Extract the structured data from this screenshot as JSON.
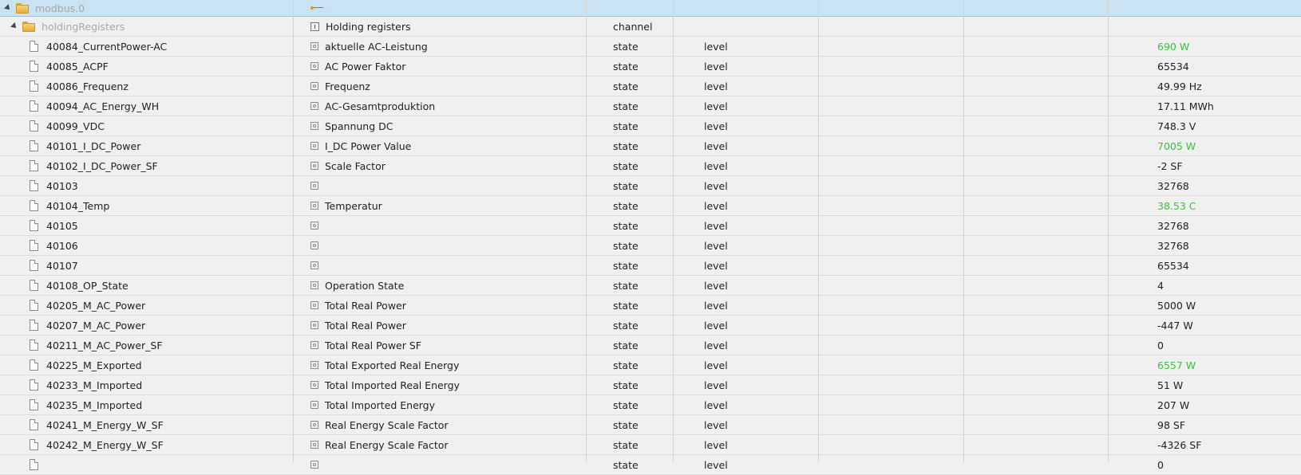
{
  "root": {
    "name": "modbus.0"
  },
  "channel": {
    "name": "holdingRegisters",
    "description": "Holding registers",
    "type": "channel"
  },
  "rows": [
    {
      "name": "40084_CurrentPower-AC",
      "description": "aktuelle AC-Leistung",
      "type": "state",
      "role": "level",
      "value": "690 W",
      "highlight": true
    },
    {
      "name": "40085_ACPF",
      "description": "AC Power Faktor",
      "type": "state",
      "role": "level",
      "value": "65534",
      "highlight": false
    },
    {
      "name": "40086_Frequenz",
      "description": "Frequenz",
      "type": "state",
      "role": "level",
      "value": "49.99 Hz",
      "highlight": false
    },
    {
      "name": "40094_AC_Energy_WH",
      "description": "AC-Gesamtproduktion",
      "type": "state",
      "role": "level",
      "value": "17.11 MWh",
      "highlight": false
    },
    {
      "name": "40099_VDC",
      "description": "Spannung DC",
      "type": "state",
      "role": "level",
      "value": "748.3 V",
      "highlight": false
    },
    {
      "name": "40101_I_DC_Power",
      "description": "I_DC Power Value",
      "type": "state",
      "role": "level",
      "value": "7005 W",
      "highlight": true
    },
    {
      "name": "40102_I_DC_Power_SF",
      "description": "Scale Factor",
      "type": "state",
      "role": "level",
      "value": "-2 SF",
      "highlight": false
    },
    {
      "name": "40103",
      "description": "",
      "type": "state",
      "role": "level",
      "value": "32768",
      "highlight": false
    },
    {
      "name": "40104_Temp",
      "description": "Temperatur",
      "type": "state",
      "role": "level",
      "value": "38.53 C",
      "highlight": true
    },
    {
      "name": "40105",
      "description": "",
      "type": "state",
      "role": "level",
      "value": "32768",
      "highlight": false
    },
    {
      "name": "40106",
      "description": "",
      "type": "state",
      "role": "level",
      "value": "32768",
      "highlight": false
    },
    {
      "name": "40107",
      "description": "",
      "type": "state",
      "role": "level",
      "value": "65534",
      "highlight": false
    },
    {
      "name": "40108_OP_State",
      "description": "Operation State",
      "type": "state",
      "role": "level",
      "value": "4",
      "highlight": false
    },
    {
      "name": "40205_M_AC_Power",
      "description": "Total Real Power",
      "type": "state",
      "role": "level",
      "value": "5000 W",
      "highlight": false
    },
    {
      "name": "40207_M_AC_Power",
      "description": "Total Real Power",
      "type": "state",
      "role": "level",
      "value": "-447 W",
      "highlight": false
    },
    {
      "name": "40211_M_AC_Power_SF",
      "description": "Total Real Power SF",
      "type": "state",
      "role": "level",
      "value": "0",
      "highlight": false
    },
    {
      "name": "40225_M_Exported",
      "description": "Total Exported Real Energy",
      "type": "state",
      "role": "level",
      "value": "6557 W",
      "highlight": true
    },
    {
      "name": "40233_M_Imported",
      "description": "Total Imported Real Energy",
      "type": "state",
      "role": "level",
      "value": "51 W",
      "highlight": false
    },
    {
      "name": "40235_M_Imported",
      "description": "Total Imported Energy",
      "type": "state",
      "role": "level",
      "value": "207 W",
      "highlight": false
    },
    {
      "name": "40241_M_Energy_W_SF",
      "description": "Real Energy Scale Factor",
      "type": "state",
      "role": "level",
      "value": "98 SF",
      "highlight": false
    },
    {
      "name": "40242_M_Energy_W_SF",
      "description": "Real Energy Scale Factor",
      "type": "state",
      "role": "level",
      "value": "-4326 SF",
      "highlight": false
    },
    {
      "name": "",
      "description": "",
      "type": "state",
      "role": "level",
      "value": "0",
      "highlight": false
    }
  ],
  "colors": {
    "highlight_value": "#3cc23c",
    "root_bg": "#c9e3f4"
  }
}
